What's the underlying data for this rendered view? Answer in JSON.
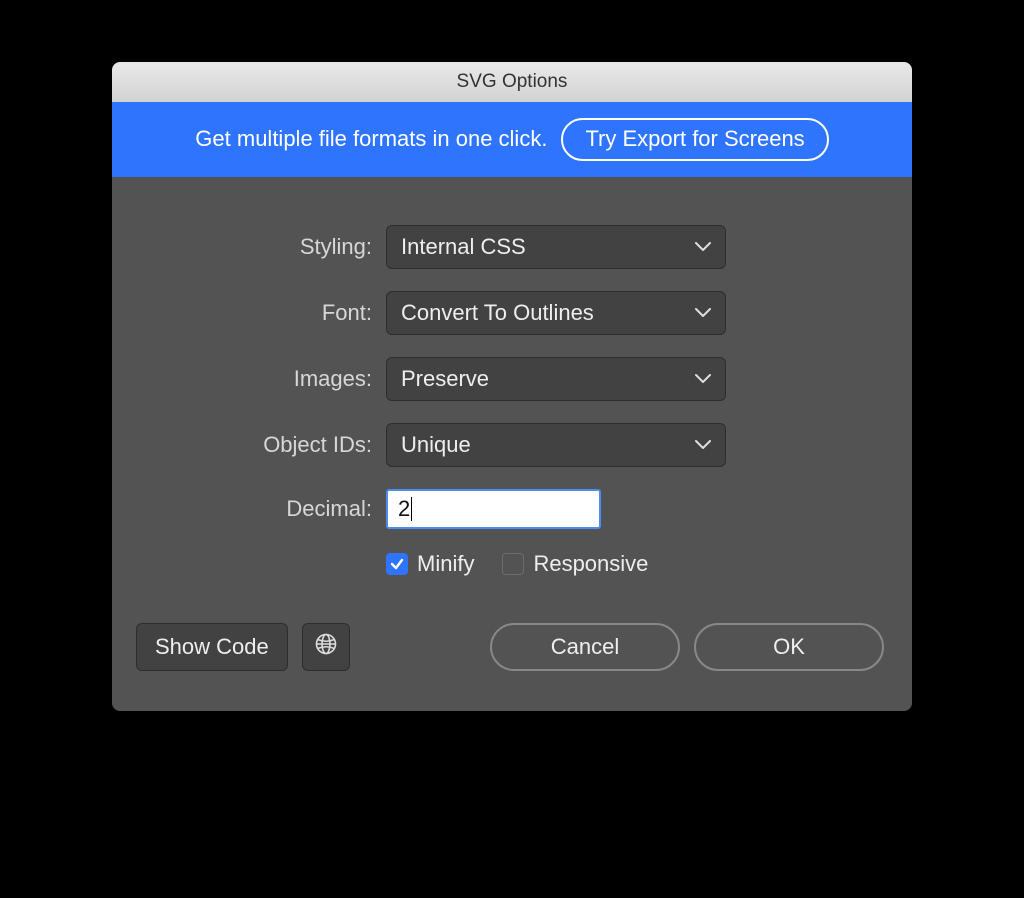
{
  "title": "SVG Options",
  "banner": {
    "text": "Get multiple file formats in one click.",
    "button": "Try Export for Screens"
  },
  "fields": {
    "styling": {
      "label": "Styling:",
      "value": "Internal CSS"
    },
    "font": {
      "label": "Font:",
      "value": "Convert To Outlines"
    },
    "images": {
      "label": "Images:",
      "value": "Preserve"
    },
    "objectIds": {
      "label": "Object IDs:",
      "value": "Unique"
    },
    "decimal": {
      "label": "Decimal:",
      "value": "2"
    }
  },
  "checks": {
    "minify": {
      "label": "Minify",
      "checked": true
    },
    "responsive": {
      "label": "Responsive",
      "checked": false
    }
  },
  "buttons": {
    "showCode": "Show Code",
    "cancel": "Cancel",
    "ok": "OK"
  }
}
